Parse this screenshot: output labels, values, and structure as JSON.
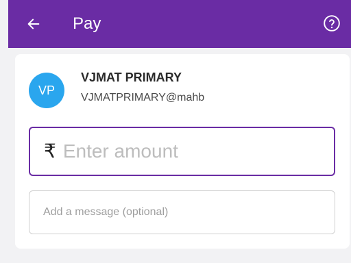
{
  "header": {
    "title": "Pay",
    "back_icon": "arrow-left-icon",
    "help_icon": "help-circle-icon"
  },
  "payee": {
    "initials": "VP",
    "name": "VJMAT PRIMARY",
    "upi_id": "VJMATPRIMARY@mahb"
  },
  "amount": {
    "currency_symbol": "₹",
    "value": "",
    "placeholder": "Enter amount"
  },
  "message": {
    "value": "",
    "placeholder": "Add a message (optional)"
  },
  "colors": {
    "header_bg": "#6a2ca4",
    "avatar_bg": "#2aa6ee",
    "focus_border": "#6a2ca4"
  }
}
